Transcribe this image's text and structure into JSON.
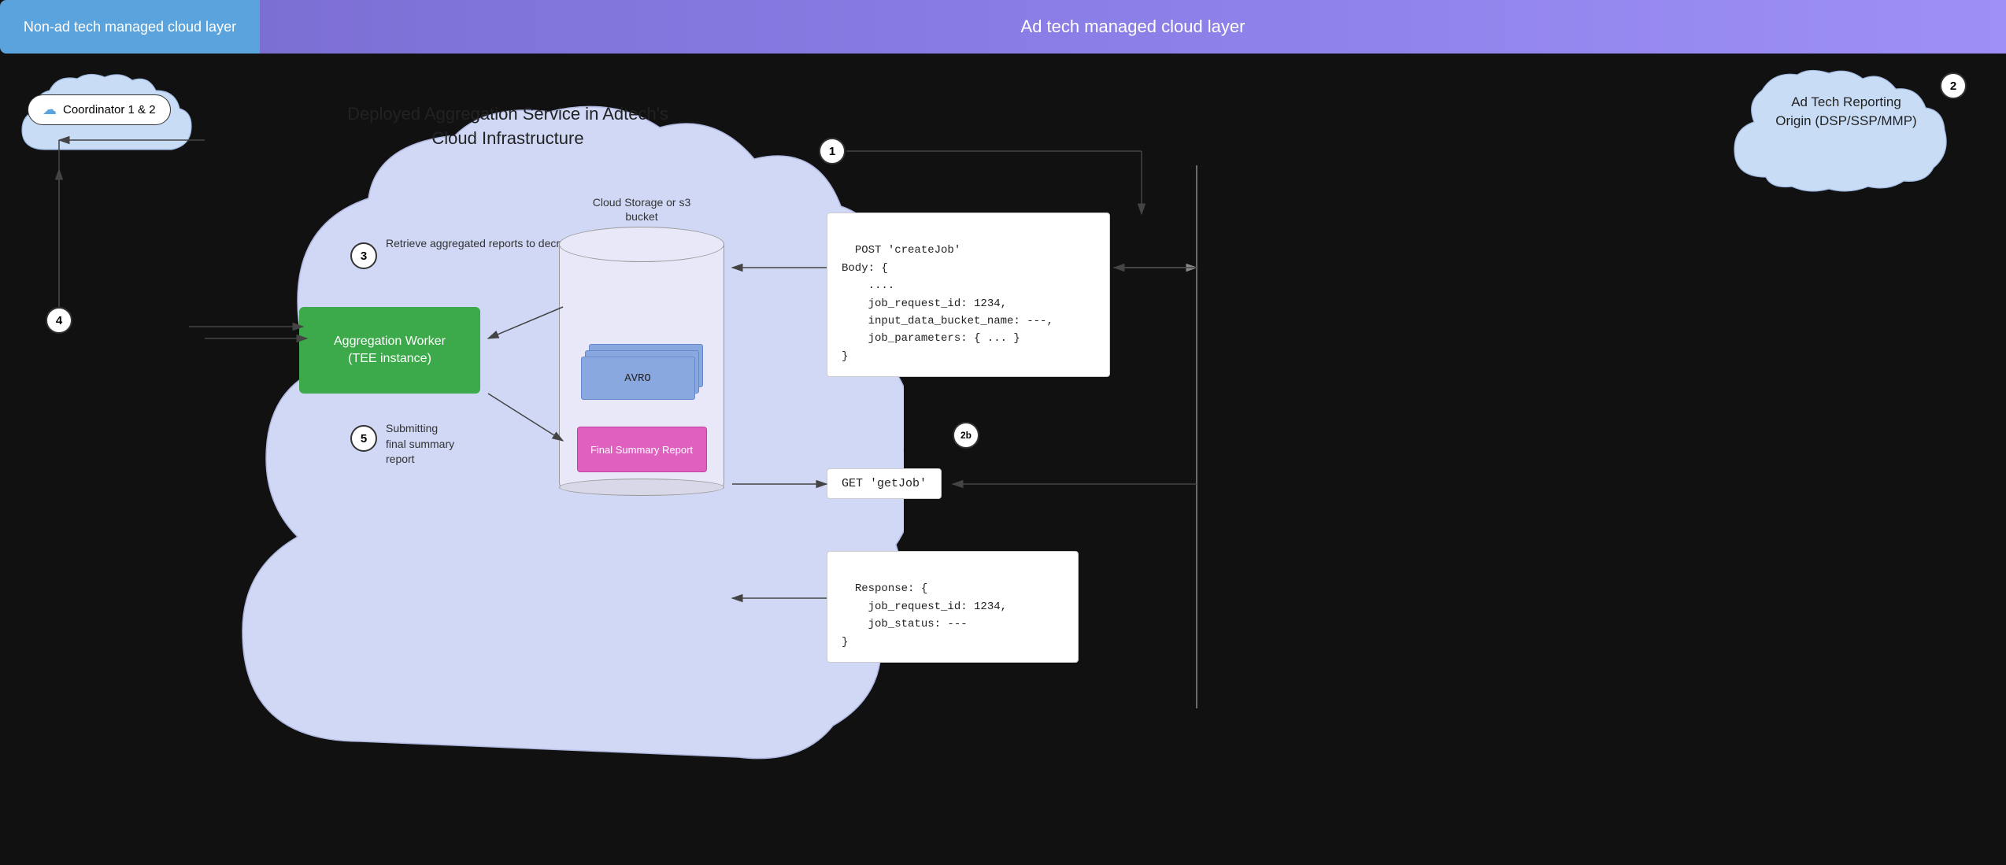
{
  "layers": {
    "left_label": "Non-ad tech managed cloud layer",
    "right_label": "Ad tech managed cloud layer"
  },
  "coordinator": {
    "label": "Coordinator 1 & 2"
  },
  "adtech_cloud": {
    "label": "Ad Tech Reporting\nOrigin (DSP/SSP/MMP)"
  },
  "main_service": {
    "title": "Deployed Aggregation Service in Adtech's\nCloud Infrastructure"
  },
  "worker_box": {
    "label": "Aggregation Worker\n(TEE instance)"
  },
  "storage": {
    "label": "Cloud Storage or s3\nbucket",
    "avro_label": "AVRO",
    "fsr_label": "Final Summary Report"
  },
  "steps": {
    "num1": "1",
    "num2": "2",
    "num2b": "2b",
    "num3": "3",
    "num4": "4",
    "num5": "5",
    "step3_label": "Retrieve\naggregated reports\nto decrypt",
    "step5_label": "Submitting\nfinal summary\nreport"
  },
  "code_box_top": {
    "content": "POST 'createJob'\nBody: {\n    ....\n    job_request_id: 1234,\n    input_data_bucket_name: ---,\n    job_parameters: { ... }\n}"
  },
  "get_job_box": {
    "content": "GET 'getJob'"
  },
  "response_box": {
    "content": "Response: {\n    job_request_id: 1234,\n    job_status: ---\n}"
  }
}
